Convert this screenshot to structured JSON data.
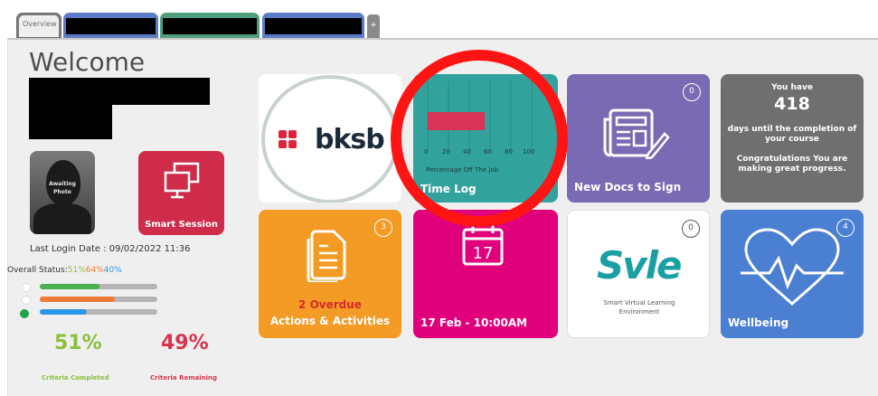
{
  "tabs": {
    "overview": "Overview",
    "plus": "+"
  },
  "header": {
    "welcome": "Welcome"
  },
  "profile": {
    "photo_text_line1": "Awaiting",
    "photo_text_line2": "Photo",
    "last_login": "Last Login Date : 09/02/2022 11:36"
  },
  "smart_session": {
    "label": "Smart Session"
  },
  "status": {
    "label": "Overall Status:",
    "v1": "51%",
    "v2": "64%",
    "v3": "40%",
    "bars": [
      {
        "color": "#4caf50",
        "percent": 51
      },
      {
        "color": "#ef7a35",
        "percent": 64
      },
      {
        "color": "#2c95e6",
        "percent": 40
      }
    ],
    "completed_value": "51%",
    "completed_label": "Criteria Completed",
    "remaining_value": "49%",
    "remaining_label": "Criteria Remaining"
  },
  "tiles": {
    "bksb_text": "bksb",
    "timelog": {
      "label": "Time Log",
      "axis_label": "Percentage Off The Job",
      "ticks": [
        "0",
        "20",
        "40",
        "60",
        "80",
        "100"
      ],
      "value": 55
    },
    "docs": {
      "label": "New Docs to Sign",
      "badge": "0"
    },
    "course": {
      "line1": "You have",
      "days": "418",
      "line2": "days until the completion of",
      "line3": "your course",
      "line4": "Congratulations You are",
      "line5": "making great progress."
    },
    "actions": {
      "badge": "3",
      "overdue": "2 Overdue",
      "label": "Actions & Activities"
    },
    "calendar": {
      "day": "17",
      "label": "17 Feb - 10:00AM"
    },
    "svle": {
      "badge": "0",
      "logo": "Svle",
      "caption1": "Smart Virtual Learning",
      "caption2": "Environment"
    },
    "wellbeing": {
      "badge": "4",
      "label": "Wellbeing"
    }
  },
  "colors": {
    "bksb_red": "#e0233c",
    "timelog_bg": "#31a39c",
    "annotation": "#ff1414"
  }
}
